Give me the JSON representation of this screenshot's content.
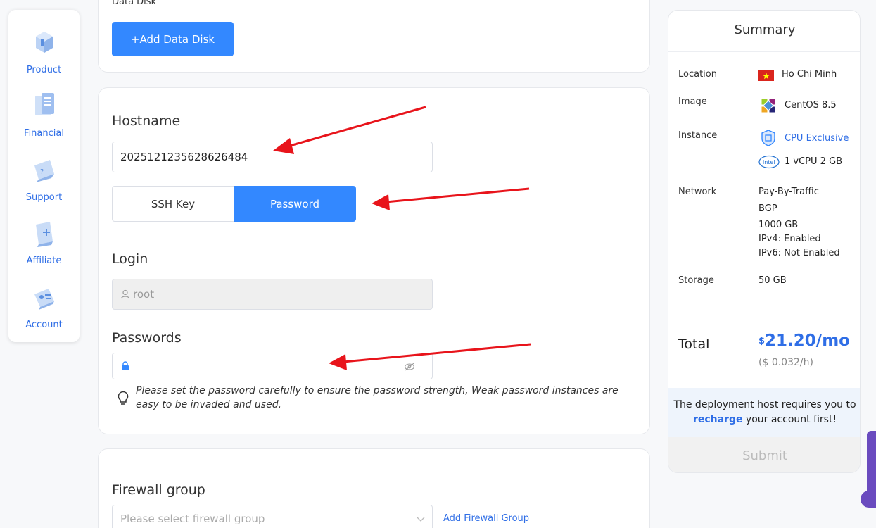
{
  "sidebar": {
    "items": [
      {
        "label": "Product",
        "icon": "product-icon"
      },
      {
        "label": "Financial",
        "icon": "financial-icon"
      },
      {
        "label": "Support",
        "icon": "support-icon"
      },
      {
        "label": "Affiliate",
        "icon": "affiliate-icon"
      },
      {
        "label": "Account",
        "icon": "account-icon"
      }
    ]
  },
  "data_disk": {
    "title": "Data Disk",
    "add_button": "+Add Data Disk"
  },
  "hostname": {
    "title": "Hostname",
    "value": "2025121235628626484"
  },
  "auth_tabs": {
    "ssh_key": "SSH Key",
    "password": "Password",
    "active": "Password"
  },
  "login": {
    "title": "Login",
    "value": "root"
  },
  "passwords": {
    "title": "Passwords",
    "value": "",
    "hint": "Please set the password carefully to ensure the password strength, Weak password instances are easy to be invaded and used."
  },
  "firewall": {
    "title": "Firewall group",
    "placeholder": "Please select firewall group",
    "add_link": "Add Firewall Group"
  },
  "summary": {
    "title": "Summary",
    "location_label": "Location",
    "location_value": "Ho Chi Minh",
    "image_label": "Image",
    "image_value": "CentOS 8.5",
    "instance_label": "Instance",
    "instance_type": "CPU Exclusive",
    "instance_spec": "1 vCPU 2 GB",
    "network_label": "Network",
    "network_lines": [
      "Pay-By-Traffic",
      "BGP",
      "1000 GB",
      "IPv4: Enabled",
      "IPv6: Not Enabled"
    ],
    "storage_label": "Storage",
    "storage_value": "50 GB",
    "total_label": "Total",
    "price_currency": "$",
    "price_amount": "21.20/mo",
    "price_hourly": "($ 0.032/h)",
    "notice_before": "The deployment host requires you to",
    "notice_link": "recharge",
    "notice_after": " your account first!",
    "submit": "Submit"
  },
  "colors": {
    "accent": "#3388ff",
    "link": "#2f6ee6",
    "annotation_arrow": "#e8141b"
  }
}
